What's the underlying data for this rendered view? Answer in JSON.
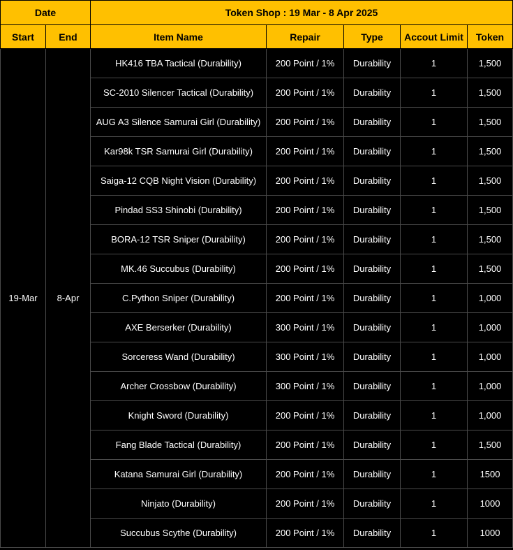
{
  "header": {
    "date_label": "Date",
    "title": "Token Shop : 19 Mar - 8 Apr 2025",
    "columns": [
      "Start",
      "End",
      "Item Name",
      "Repair",
      "Type",
      "Accout Limit",
      "Token"
    ]
  },
  "period": {
    "start": "19-Mar",
    "end": "8-Apr"
  },
  "items": [
    {
      "name": "HK416 TBA Tactical (Durability)",
      "repair": "200 Point / 1%",
      "type": "Durability",
      "limit": "1",
      "token": "1,500"
    },
    {
      "name": "SC-2010 Silencer Tactical (Durability)",
      "repair": "200 Point / 1%",
      "type": "Durability",
      "limit": "1",
      "token": "1,500"
    },
    {
      "name": "AUG A3 Silence Samurai Girl (Durability)",
      "repair": "200 Point / 1%",
      "type": "Durability",
      "limit": "1",
      "token": "1,500"
    },
    {
      "name": "Kar98k TSR Samurai Girl (Durability)",
      "repair": "200 Point / 1%",
      "type": "Durability",
      "limit": "1",
      "token": "1,500"
    },
    {
      "name": "Saiga-12 CQB Night Vision (Durability)",
      "repair": "200 Point / 1%",
      "type": "Durability",
      "limit": "1",
      "token": "1,500"
    },
    {
      "name": "Pindad SS3 Shinobi (Durability)",
      "repair": "200 Point / 1%",
      "type": "Durability",
      "limit": "1",
      "token": "1,500"
    },
    {
      "name": "BORA-12 TSR Sniper (Durability)",
      "repair": "200 Point / 1%",
      "type": "Durability",
      "limit": "1",
      "token": "1,500"
    },
    {
      "name": "MK.46 Succubus (Durability)",
      "repair": "200 Point / 1%",
      "type": "Durability",
      "limit": "1",
      "token": "1,500"
    },
    {
      "name": "C.Python Sniper (Durability)",
      "repair": "200 Point / 1%",
      "type": "Durability",
      "limit": "1",
      "token": "1,000"
    },
    {
      "name": "AXE Berserker (Durability)",
      "repair": "300 Point / 1%",
      "type": "Durability",
      "limit": "1",
      "token": "1,000"
    },
    {
      "name": "Sorceress Wand (Durability)",
      "repair": "300 Point / 1%",
      "type": "Durability",
      "limit": "1",
      "token": "1,000"
    },
    {
      "name": "Archer Crossbow (Durability)",
      "repair": "300 Point / 1%",
      "type": "Durability",
      "limit": "1",
      "token": "1,000"
    },
    {
      "name": "Knight Sword (Durability)",
      "repair": "200 Point / 1%",
      "type": "Durability",
      "limit": "1",
      "token": "1,000"
    },
    {
      "name": "Fang Blade Tactical (Durability)",
      "repair": "200 Point / 1%",
      "type": "Durability",
      "limit": "1",
      "token": "1,500"
    },
    {
      "name": "Katana Samurai Girl (Durability)",
      "repair": "200 Point / 1%",
      "type": "Durability",
      "limit": "1",
      "token": "1500"
    },
    {
      "name": "Ninjato (Durability)",
      "repair": "200 Point / 1%",
      "type": "Durability",
      "limit": "1",
      "token": "1000"
    },
    {
      "name": "Succubus Scythe (Durability)",
      "repair": "200 Point / 1%",
      "type": "Durability",
      "limit": "1",
      "token": "1000"
    }
  ],
  "colors": {
    "header_bg": "#ffc000",
    "body_bg": "#000000",
    "grid": "#4a4a4a"
  }
}
